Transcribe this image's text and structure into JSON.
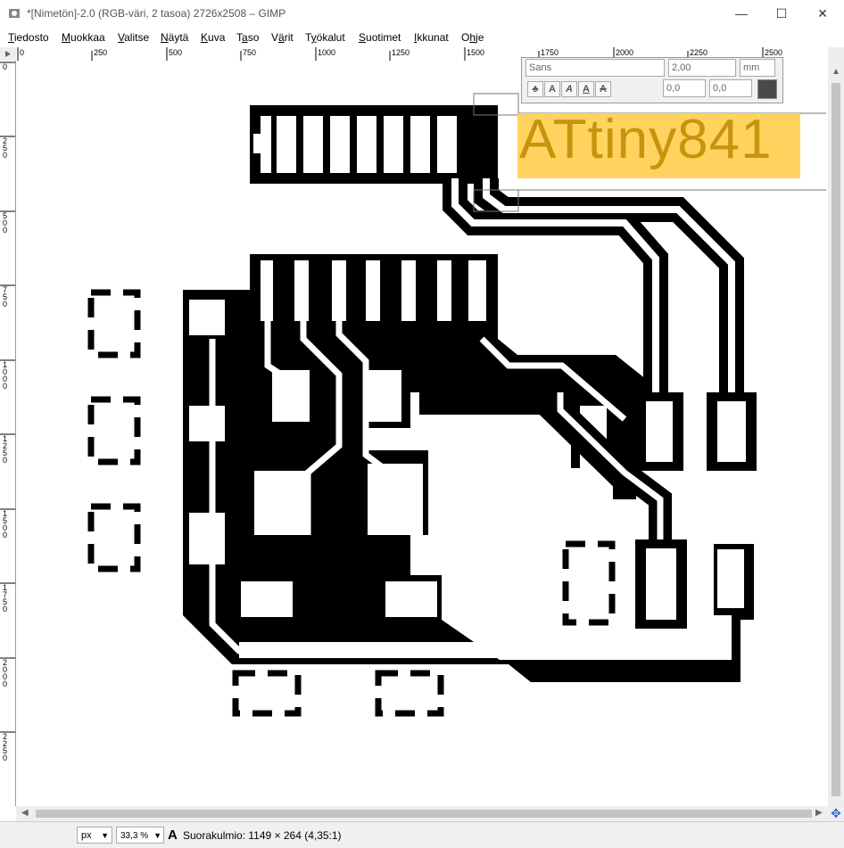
{
  "window": {
    "title": "*[Nimetön]-2.0 (RGB-väri, 2 tasoa) 2726x2508 – GIMP",
    "minimize": "—",
    "maximize": "☐",
    "close": "✕"
  },
  "menu": {
    "items": [
      {
        "u": "T",
        "rest": "iedosto"
      },
      {
        "u": "M",
        "rest": "uokkaa"
      },
      {
        "u": "V",
        "rest": "alitse"
      },
      {
        "u": "N",
        "rest": "äytä"
      },
      {
        "u": "K",
        "rest": "uva"
      },
      {
        "pre": "T",
        "u": "a",
        "rest": "so"
      },
      {
        "pre": "V",
        "u": "ä",
        "rest": "rit"
      },
      {
        "pre": "T",
        "u": "y",
        "rest": "ökalut"
      },
      {
        "u": "S",
        "rest": "uotimet"
      },
      {
        "u": "I",
        "rest": "kkunat"
      },
      {
        "pre": "O",
        "u": "h",
        "rest": "je"
      }
    ]
  },
  "ruler": {
    "h_labels": [
      "0",
      "250",
      "500",
      "750",
      "1000",
      "1250",
      "1500",
      "1750",
      "2000",
      "2250",
      "2500"
    ],
    "v_labels": [
      "0",
      "250",
      "500",
      "750",
      "1000",
      "1250",
      "1500",
      "1750",
      "2000",
      "2250"
    ]
  },
  "text_tool": {
    "font": "Sans",
    "size": "2,00",
    "unit": "mm",
    "x_offset": "0,0",
    "y_offset": "0,0",
    "buttons": [
      "A",
      "A",
      "A",
      "A"
    ],
    "color": "#4a4a4a"
  },
  "canvas": {
    "text_layer": "ATtiny841",
    "text_color": "#c8940e",
    "highlight_color": "#ffd35e"
  },
  "statusbar": {
    "unit": "px",
    "zoom": "33,3 %",
    "message": "Suorakulmio: 1149 × 264  (4,35:1)"
  }
}
